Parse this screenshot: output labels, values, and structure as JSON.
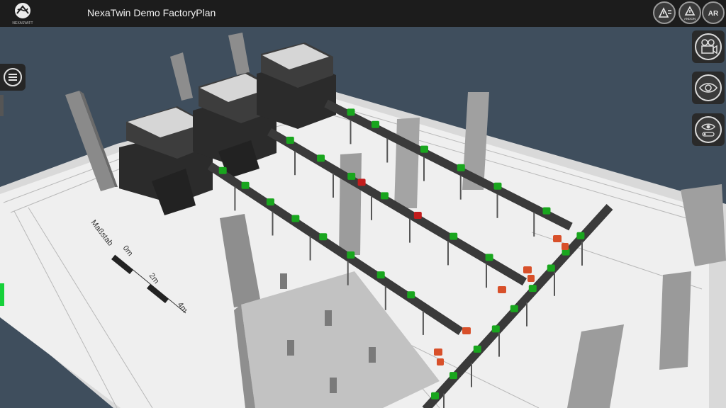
{
  "header": {
    "logo_text": "NEXASWIFT",
    "title": "NexaTwin Demo FactoryPlan",
    "buttons": [
      {
        "name": "alerts",
        "icon": "warning-list-icon"
      },
      {
        "name": "andon",
        "icon": "andon-warning-icon",
        "label": "ANDON"
      },
      {
        "name": "ar",
        "icon": "ar-icon",
        "label": "AR"
      }
    ]
  },
  "side_buttons": [
    {
      "name": "camera",
      "icon": "movie-camera-icon"
    },
    {
      "name": "visibility",
      "icon": "eye-icon"
    },
    {
      "name": "visibility-settings",
      "icon": "eye-settings-icon"
    }
  ],
  "menu": {
    "icon": "hamburger-menu-icon"
  },
  "scene": {
    "scale_label": "Maßstab",
    "scale_ticks": [
      "0m",
      "2m",
      "4m"
    ]
  },
  "colors": {
    "background": "#3f4e5d",
    "floor": "#e4e4e4",
    "conveyor": "#3a3a3a",
    "ok_part": "#19a61e",
    "error_part": "#c21c1c",
    "robot": "#d8502a",
    "status_indicator": "#16d13a"
  }
}
